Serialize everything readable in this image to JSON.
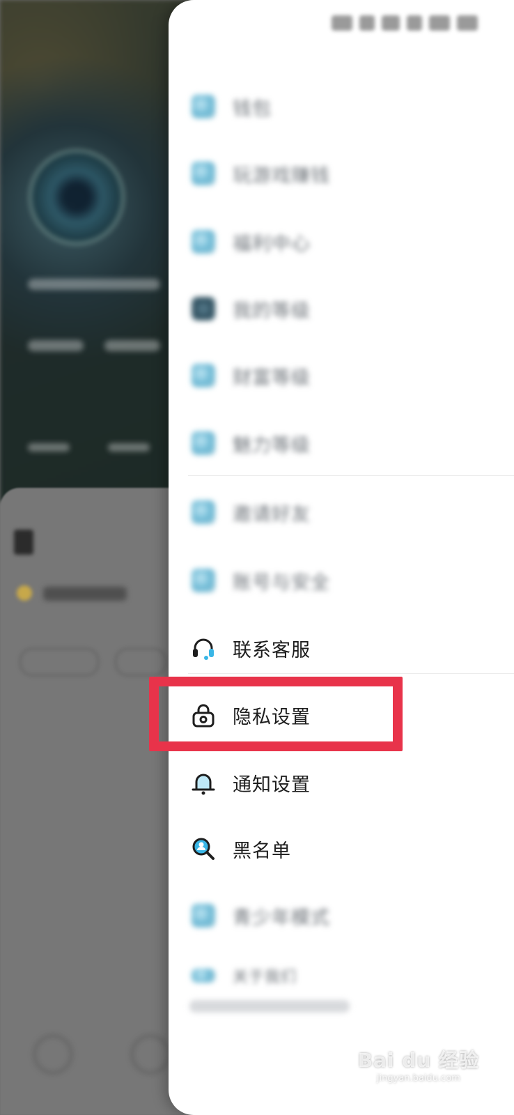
{
  "drawer": {
    "items": [
      {
        "label": "钱包",
        "icon": "wallet-icon"
      },
      {
        "label": "玩游戏赚钱",
        "icon": "game-icon"
      },
      {
        "label": "福利中心",
        "icon": "gift-icon"
      },
      {
        "label": "我的等级",
        "icon": "level-icon"
      },
      {
        "label": "财富等级",
        "icon": "wealth-icon"
      },
      {
        "label": "魅力等级",
        "icon": "charm-icon"
      },
      {
        "label": "邀请好友",
        "icon": "invite-icon"
      },
      {
        "label": "账号与安全",
        "icon": "shield-icon"
      },
      {
        "label": "联系客服",
        "icon": "headset-icon"
      },
      {
        "label": "隐私设置",
        "icon": "lock-icon"
      },
      {
        "label": "通知设置",
        "icon": "bell-icon"
      },
      {
        "label": "黑名单",
        "icon": "search-user-icon"
      },
      {
        "label": "青少年模式",
        "icon": "teen-mode-icon"
      },
      {
        "label": "关于我们",
        "icon": "info-icon"
      }
    ]
  },
  "watermark": {
    "brand": "Bai du 经验",
    "url": "jingyan.baidu.com"
  },
  "colors": {
    "highlight": "#e8334a",
    "icon_accent": "#39b6e6"
  }
}
